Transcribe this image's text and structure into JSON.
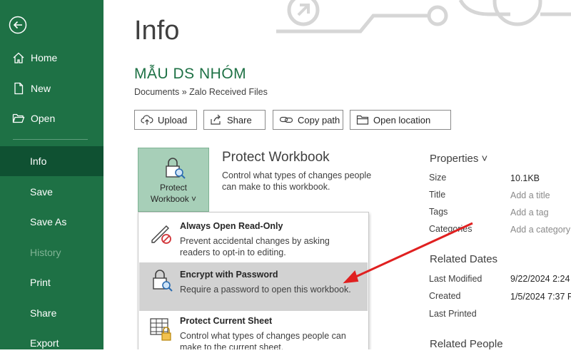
{
  "sidebar": {
    "items": [
      {
        "label": "Home"
      },
      {
        "label": "New"
      },
      {
        "label": "Open"
      },
      {
        "label": "Info"
      },
      {
        "label": "Save"
      },
      {
        "label": "Save As"
      },
      {
        "label": "History"
      },
      {
        "label": "Print"
      },
      {
        "label": "Share"
      },
      {
        "label": "Export"
      }
    ]
  },
  "main": {
    "title": "Info",
    "workbook_name": "MẪU DS NHÓM",
    "path": "Documents » Zalo Received Files",
    "actions": [
      {
        "label": "Upload"
      },
      {
        "label": "Share"
      },
      {
        "label": "Copy path"
      },
      {
        "label": "Open location"
      }
    ],
    "protect": {
      "tile_label_1": "Protect",
      "tile_label_2": "Workbook ˅",
      "title": "Protect Workbook",
      "description": "Control what types of changes people can make to this workbook."
    },
    "menu": [
      {
        "title": "Always Open Read-Only",
        "description": "Prevent accidental changes by asking readers to opt-in to editing."
      },
      {
        "title": "Encrypt with Password",
        "description": "Require a password to open this workbook."
      },
      {
        "title": "Protect Current Sheet",
        "description": "Control what types of changes people can make to the current sheet."
      }
    ]
  },
  "properties": {
    "heading": "Properties ˅",
    "rows": [
      {
        "label": "Size",
        "value": "10.1KB"
      },
      {
        "label": "Title",
        "value": "Add a title"
      },
      {
        "label": "Tags",
        "value": "Add a tag"
      },
      {
        "label": "Categories",
        "value": "Add a category"
      }
    ],
    "related_dates_heading": "Related Dates",
    "dates": [
      {
        "label": "Last Modified",
        "value": "9/22/2024 2:24"
      },
      {
        "label": "Created",
        "value": "1/5/2024 7:37 P"
      },
      {
        "label": "Last Printed",
        "value": ""
      }
    ],
    "related_people_heading": "Related People"
  },
  "colors": {
    "accent": "#1e7145",
    "active": "#0f5132",
    "tile": "#a7cfb8",
    "arrow": "#e02020"
  }
}
